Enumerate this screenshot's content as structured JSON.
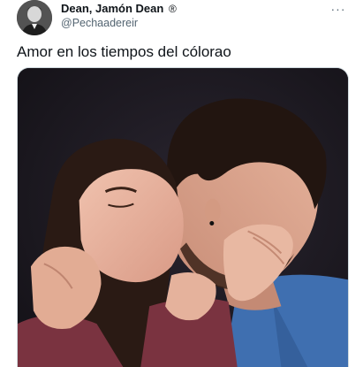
{
  "tweet": {
    "author": {
      "display_name": "Dean, Jamón Dean",
      "badge": "®",
      "handle": "@Pechaadereir",
      "avatar_icon": "profile-photo"
    },
    "more_icon": "more-dots-icon",
    "more_label": "···",
    "text": "Amor en los tiempos del cólorao",
    "media": {
      "kind": "photo",
      "colors": {
        "background": "#1c1920",
        "skin": "#e7b49e",
        "hair_dark": "#2a1a14",
        "shirt_left": "#7a3340",
        "shirt_right": "#3f6fb0"
      }
    }
  }
}
